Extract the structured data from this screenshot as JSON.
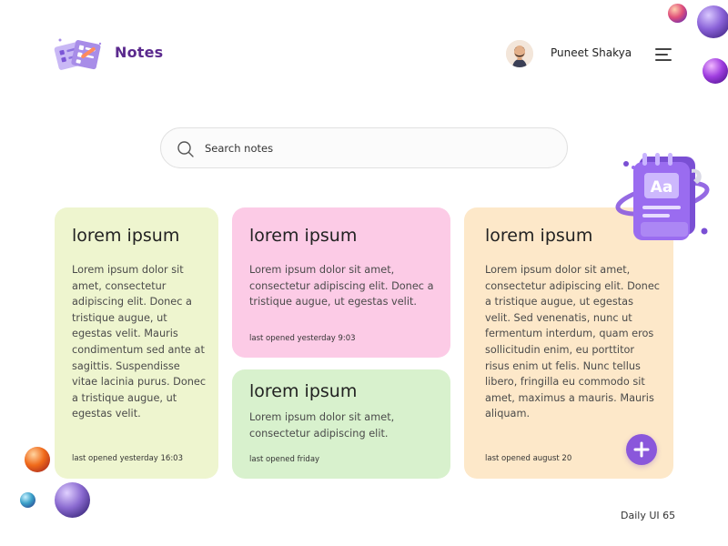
{
  "app": {
    "title": "Notes",
    "logo_icon": "notes-stack-icon"
  },
  "user": {
    "name": "Puneet Shakya",
    "avatar_icon": "user-avatar"
  },
  "menu": {
    "icon": "hamburger-menu-icon"
  },
  "search": {
    "placeholder": "Search notes",
    "value": "",
    "icon": "search-icon"
  },
  "notes": [
    {
      "title": "lorem ipsum",
      "body": "Lorem ipsum dolor sit amet, consectetur adipiscing elit. Donec a tristique augue, ut egestas velit. Mauris condimentum sed ante at sagittis. Suspendisse vitae lacinia purus. Donec a tristique augue, ut egestas velit.",
      "last_opened": "last opened yesterday 16:03",
      "color": "#eef5cf"
    },
    {
      "title": "lorem ipsum",
      "body": "Lorem ipsum dolor sit amet, consectetur adipiscing elit. Donec a tristique augue, ut egestas velit.",
      "last_opened": "last opened yesterday 9:03",
      "color": "#fccbe6"
    },
    {
      "title": "lorem ipsum",
      "body": "Lorem ipsum dolor sit amet, consectetur adipiscing elit.",
      "last_opened": "last opened friday",
      "color": "#d8f1cd"
    },
    {
      "title": "lorem ipsum",
      "body": "Lorem ipsum dolor sit amet, consectetur adipiscing elit. Donec a tristique augue, ut egestas velit. Sed venenatis, nunc ut fermentum interdum, quam eros sollicitudin enim, eu porttitor risus enim ut felis. Nunc tellus libero, fringilla eu commodo sit amet, maximus a mauris. Mauris aliquam.",
      "last_opened": "last opened august 20",
      "color": "#fde8c9"
    }
  ],
  "add_button": {
    "icon": "plus-icon",
    "color": "#8a57db"
  },
  "decoration": {
    "illustration": "notebook-3d-illustration",
    "illustration_text": "Aa"
  },
  "footer": {
    "label": "Daily UI 65"
  },
  "colors": {
    "accent": "#8a57db",
    "brand": "#5b2a8e"
  }
}
